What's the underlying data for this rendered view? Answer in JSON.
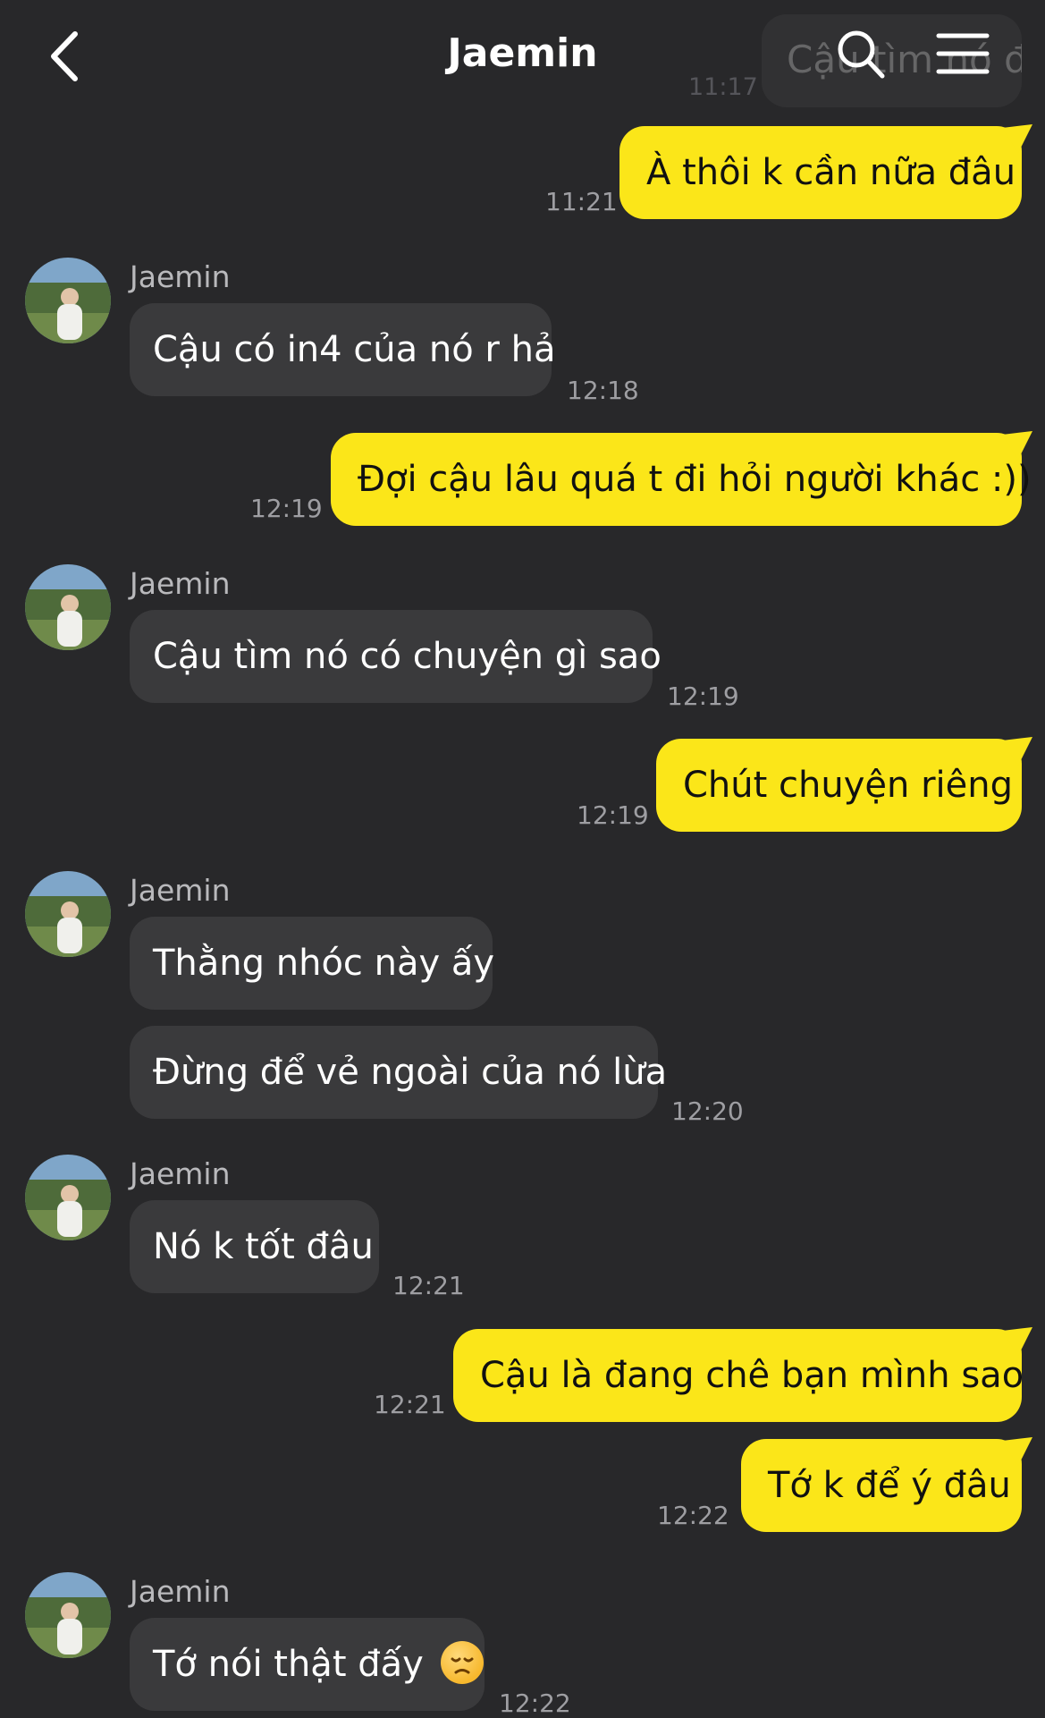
{
  "header": {
    "title": "Jaemin"
  },
  "ghost": {
    "text": "Cậu tìm nó đâu",
    "time": "11:17"
  },
  "contact": {
    "name": "Jaemin"
  },
  "colors": {
    "background": "#28282a",
    "outgoing": "#fbe619",
    "incoming": "#3a3a3c"
  },
  "messages": [
    {
      "dir": "out",
      "text": "À thôi k cần nữa đâu",
      "time": "11:21"
    },
    {
      "dir": "in",
      "sender": "Jaemin",
      "text": "Cậu có in4 của nó r hả",
      "time": "12:18"
    },
    {
      "dir": "out",
      "text": "Đợi cậu lâu quá t đi hỏi người khác :))",
      "time": "12:19"
    },
    {
      "dir": "in",
      "sender": "Jaemin",
      "text": "Cậu tìm nó có chuyện gì sao",
      "time": "12:19"
    },
    {
      "dir": "out",
      "text": "Chút chuyện riêng",
      "time": "12:19"
    },
    {
      "dir": "in",
      "sender": "Jaemin",
      "text": "Thằng nhóc này ấy"
    },
    {
      "dir": "in",
      "text": "Đừng để vẻ ngoài của nó lừa",
      "time": "12:20"
    },
    {
      "dir": "in",
      "sender": "Jaemin",
      "text": "Nó k tốt đâu",
      "time": "12:21"
    },
    {
      "dir": "out",
      "text": "Cậu là đang chê bạn mình sao",
      "time": "12:21"
    },
    {
      "dir": "out",
      "text": "Tớ k để ý đâu",
      "time": "12:22"
    },
    {
      "dir": "in",
      "sender": "Jaemin",
      "text": "Tớ nói thật đấy",
      "emoji": "disappointed-face",
      "time": "12:22"
    }
  ]
}
